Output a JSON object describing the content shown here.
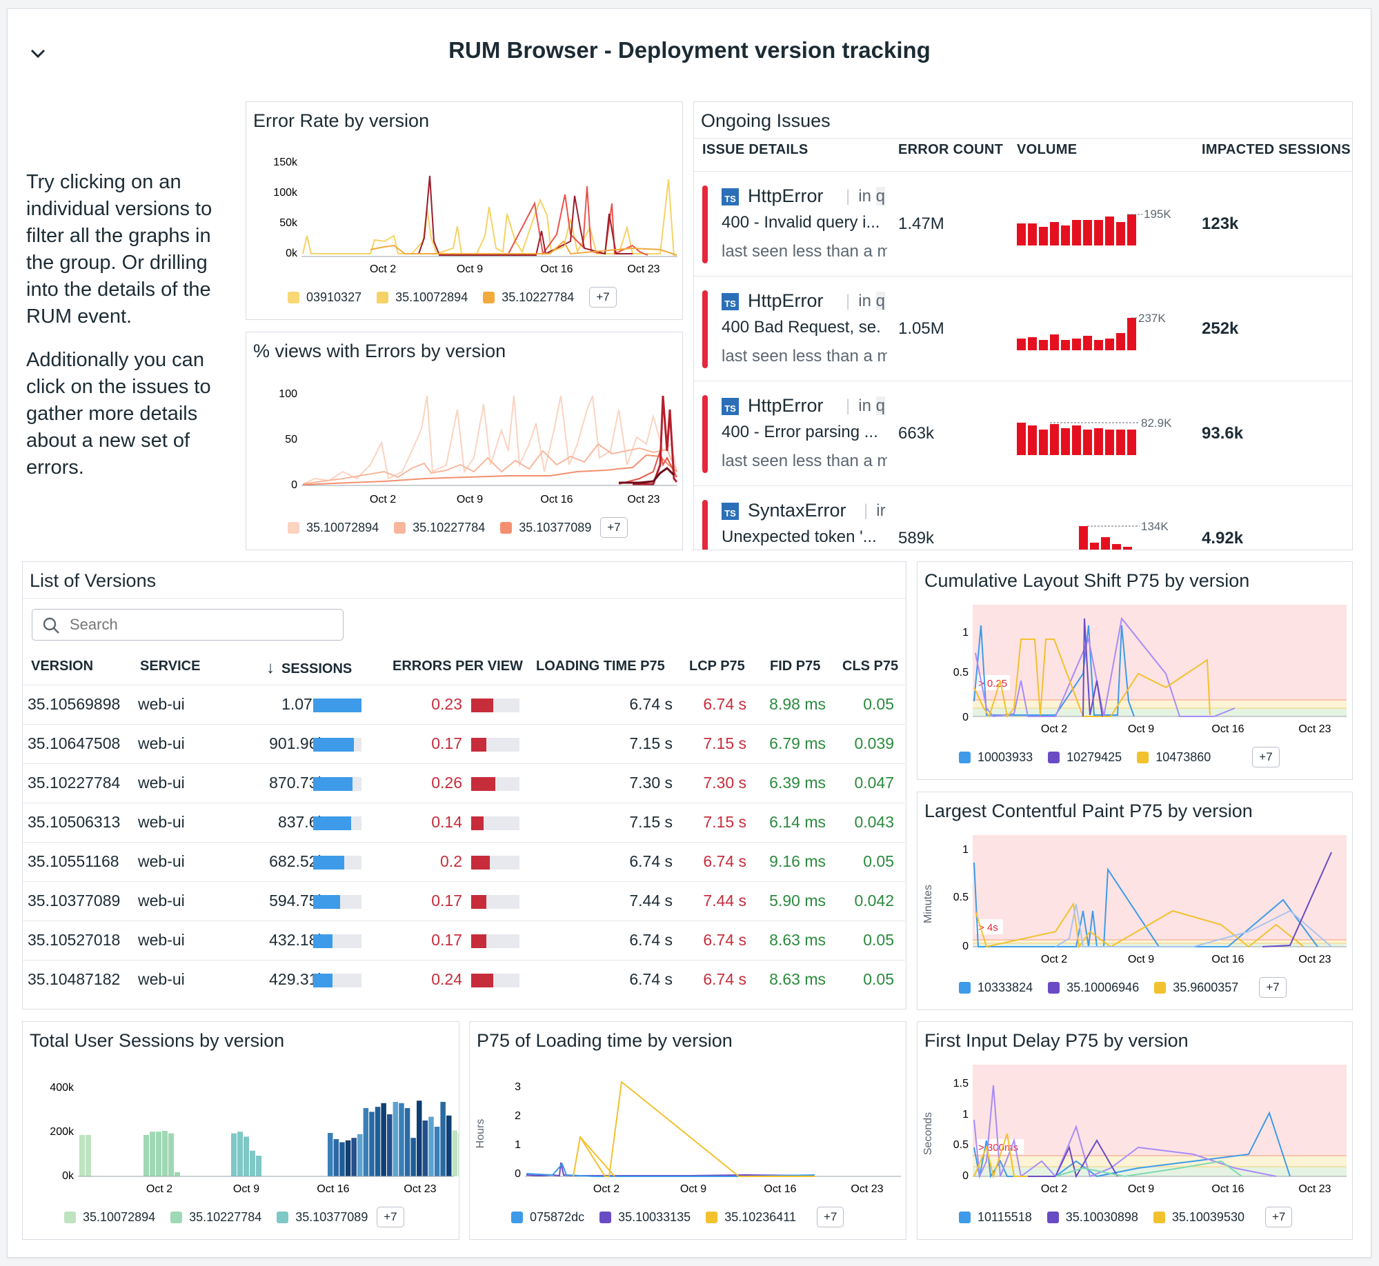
{
  "header": {
    "title": "RUM Browser - Deployment version tracking"
  },
  "description": {
    "p1": "Try clicking on an individual versions to filter all the graphs in the group. Or drilling into the details of the RUM event.",
    "p2": "Additionally you can click on the issues to gather more details about a new set of errors."
  },
  "x_ticks": [
    "Oct 2",
    "Oct 9",
    "Oct 16",
    "Oct 23"
  ],
  "error_rate": {
    "title": "Error Rate by version",
    "y_ticks": [
      "150k",
      "100k",
      "50k",
      "0k"
    ],
    "legend": [
      {
        "label": "03910327",
        "color": "#f8d774"
      },
      {
        "label": "35.10072894",
        "color": "#f6d264"
      },
      {
        "label": "35.10227784",
        "color": "#f2a93b"
      }
    ],
    "more": "+7"
  },
  "views_errors": {
    "title": "% views with Errors by version",
    "y_ticks": [
      "100",
      "50",
      "0"
    ],
    "legend": [
      {
        "label": "35.10072894",
        "color": "#fbd3c1"
      },
      {
        "label": "35.10227784",
        "color": "#f8b79c"
      },
      {
        "label": "35.10377089",
        "color": "#f38f6f"
      }
    ],
    "more": "+7"
  },
  "issues": {
    "title": "Ongoing Issues",
    "headers": [
      "ISSUE DETAILS",
      "ERROR COUNT",
      "VOLUME",
      "IMPACTED SESSIONS"
    ],
    "items": [
      {
        "type": "HttpError",
        "in": "in",
        "in_value": "q",
        "message": "400 - Invalid query i...",
        "seen": "last seen less than a m",
        "count": "1.47M",
        "peak": "195K",
        "sessions": "123k"
      },
      {
        "type": "HttpError",
        "in": "in",
        "in_value": "q",
        "message": "400 Bad Request, se...",
        "seen": "last seen less than a m",
        "count": "1.05M",
        "peak": "237K",
        "sessions": "252k"
      },
      {
        "type": "HttpError",
        "in": "in",
        "in_value": "q",
        "message": "400 - Error parsing ...",
        "seen": "last seen less than a m",
        "count": "663k",
        "peak": "82.9K",
        "sessions": "93.6k"
      },
      {
        "type": "SyntaxError",
        "in": "ir",
        "in_value": "",
        "message": "Unexpected token '...",
        "seen": "",
        "count": "589k",
        "peak": "134K",
        "sessions": "4.92k"
      }
    ],
    "ts_badge": "TS"
  },
  "versions": {
    "title": "List of Versions",
    "search_placeholder": "Search",
    "headers": {
      "version": "VERSION",
      "service": "SERVICE",
      "sessions": "SESSIONS",
      "errors": "ERRORS PER VIEW",
      "loading": "LOADING TIME P75",
      "lcp": "LCP P75",
      "fid": "FID P75",
      "cls": "CLS P75"
    },
    "sort_arrow": "↓",
    "rows": [
      {
        "version": "35.10569898",
        "service": "web-ui",
        "sessions": "1.07M",
        "sessions_frac": 1.0,
        "errors": "0.23",
        "errors_frac": 0.45,
        "loading": "6.74 s",
        "lcp": "6.74 s",
        "fid": "8.98 ms",
        "cls": "0.05"
      },
      {
        "version": "35.10647508",
        "service": "web-ui",
        "sessions": "901.96k",
        "sessions_frac": 0.84,
        "errors": "0.17",
        "errors_frac": 0.32,
        "loading": "7.15 s",
        "lcp": "7.15 s",
        "fid": "6.79 ms",
        "cls": "0.039"
      },
      {
        "version": "35.10227784",
        "service": "web-ui",
        "sessions": "870.73k",
        "sessions_frac": 0.81,
        "errors": "0.26",
        "errors_frac": 0.5,
        "loading": "7.30 s",
        "lcp": "7.30 s",
        "fid": "6.39 ms",
        "cls": "0.047"
      },
      {
        "version": "35.10506313",
        "service": "web-ui",
        "sessions": "837.6k",
        "sessions_frac": 0.78,
        "errors": "0.14",
        "errors_frac": 0.25,
        "loading": "7.15 s",
        "lcp": "7.15 s",
        "fid": "6.14 ms",
        "cls": "0.043"
      },
      {
        "version": "35.10551168",
        "service": "web-ui",
        "sessions": "682.52k",
        "sessions_frac": 0.64,
        "errors": "0.2",
        "errors_frac": 0.38,
        "loading": "6.74 s",
        "lcp": "6.74 s",
        "fid": "9.16 ms",
        "cls": "0.05"
      },
      {
        "version": "35.10377089",
        "service": "web-ui",
        "sessions": "594.75k",
        "sessions_frac": 0.56,
        "errors": "0.17",
        "errors_frac": 0.32,
        "loading": "7.44 s",
        "lcp": "7.44 s",
        "fid": "5.90 ms",
        "cls": "0.042"
      },
      {
        "version": "35.10527018",
        "service": "web-ui",
        "sessions": "432.18k",
        "sessions_frac": 0.4,
        "errors": "0.17",
        "errors_frac": 0.32,
        "loading": "6.74 s",
        "lcp": "6.74 s",
        "fid": "8.63 ms",
        "cls": "0.05"
      },
      {
        "version": "35.10487182",
        "service": "web-ui",
        "sessions": "429.31k",
        "sessions_frac": 0.4,
        "errors": "0.24",
        "errors_frac": 0.45,
        "loading": "6.74 s",
        "lcp": "6.74 s",
        "fid": "8.63 ms",
        "cls": "0.05"
      }
    ]
  },
  "cls_chart": {
    "title": "Cumulative Layout Shift P75 by version",
    "y_ticks": [
      "1",
      "0.5",
      "0"
    ],
    "threshold": "> 0.25",
    "legend": [
      {
        "label": "10003933",
        "color": "#3d9be9"
      },
      {
        "label": "10279425",
        "color": "#6a4bc4"
      },
      {
        "label": "10473860",
        "color": "#f2c12e"
      }
    ],
    "more": "+7"
  },
  "lcp_chart": {
    "title": "Largest Contentful Paint P75 by version",
    "y_ticks": [
      "1",
      "0.5",
      "0"
    ],
    "y_unit": "Minutes",
    "threshold": "> 4s",
    "legend": [
      {
        "label": "10333824",
        "color": "#3d9be9"
      },
      {
        "label": "35.10006946",
        "color": "#6a4bc4"
      },
      {
        "label": "35.9600357",
        "color": "#f2c12e"
      }
    ],
    "more": "+7"
  },
  "sessions_chart": {
    "title": "Total User Sessions by version",
    "y_ticks": [
      "400k",
      "200k",
      "0k"
    ],
    "legend": [
      {
        "label": "35.10072894",
        "color": "#bfe3c0"
      },
      {
        "label": "35.10227784",
        "color": "#9fd8b4"
      },
      {
        "label": "35.10377089",
        "color": "#7ec8c6"
      }
    ],
    "more": "+7"
  },
  "loading_chart": {
    "title": "P75 of Loading time by version",
    "y_ticks": [
      "3",
      "2",
      "1",
      "0"
    ],
    "y_unit": "Hours",
    "legend": [
      {
        "label": "075872dc",
        "color": "#3d9be9"
      },
      {
        "label": "35.10033135",
        "color": "#6a4bc4"
      },
      {
        "label": "35.10236411",
        "color": "#f2c12e"
      }
    ],
    "more": "+7"
  },
  "fid_chart": {
    "title": "First Input Delay P75 by version",
    "y_ticks": [
      "1.5",
      "1",
      "0.5",
      "0"
    ],
    "y_unit": "Seconds",
    "threshold": "> 300ms",
    "legend": [
      {
        "label": "10115518",
        "color": "#3d9be9"
      },
      {
        "label": "35.10030898",
        "color": "#6a4bc4"
      },
      {
        "label": "35.10039530",
        "color": "#f2c12e"
      }
    ],
    "more": "+7"
  }
}
